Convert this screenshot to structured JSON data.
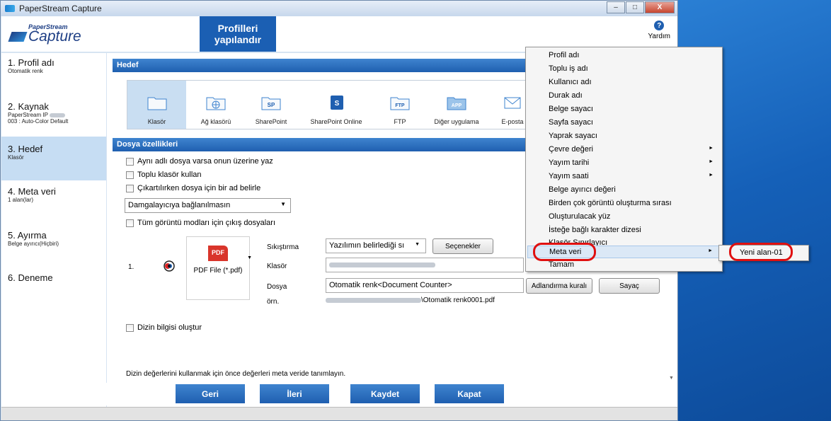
{
  "window": {
    "title": "PaperStream Capture",
    "buttons": {
      "minimize": "–",
      "maximize": "□",
      "close": "X"
    }
  },
  "header": {
    "logo_top": "PaperStream",
    "logo_bottom": "Capture",
    "tab_line1": "Profilleri",
    "tab_line2": "yapılandır",
    "help_icon": "?",
    "help_label": "Yardım"
  },
  "sidebar": {
    "steps": [
      {
        "label": "1. Profil adı",
        "sub": "Otomatik renk"
      },
      {
        "label": "2. Kaynak",
        "sub": "PaperStream IP",
        "sub2": "003 : Auto-Color Default"
      },
      {
        "label": "3. Hedef",
        "sub": "Klasör"
      },
      {
        "label": "4. Meta veri",
        "sub": "1 alan(lar)"
      },
      {
        "label": "5. Ayırma",
        "sub": "Belge ayırıcı(Hiçbiri)"
      },
      {
        "label": "6. Deneme",
        "sub": ""
      }
    ]
  },
  "destination": {
    "section_title": "Hedef",
    "items": [
      {
        "label": "Klasör",
        "icon": "folder-icon"
      },
      {
        "label": "Ağ klasörü",
        "icon": "network-folder-icon"
      },
      {
        "label": "SharePoint",
        "icon": "sharepoint-icon",
        "badge": "SP"
      },
      {
        "label": "SharePoint Online",
        "icon": "sharepoint-online-icon",
        "badge": "S"
      },
      {
        "label": "FTP",
        "icon": "ftp-icon",
        "badge": "FTP"
      },
      {
        "label": "Diğer uygulama",
        "icon": "app-icon",
        "badge": "APP"
      },
      {
        "label": "E-posta",
        "icon": "email-icon"
      }
    ]
  },
  "file_props": {
    "section_title": "Dosya özellikleri",
    "overwrite": "Aynı adlı dosya varsa onun üzerine yaz",
    "batch_folder": "Toplu klasör kullan",
    "name_on_eject": "Çıkartılırken dosya için bir ad belirle",
    "imprinter_select": "Damgalayıcıya bağlanılmasın",
    "all_modes": "Tüm görüntü modları için çıkış dosyaları",
    "row_index": "1.",
    "pdf_badge": "PDF",
    "file_type": "PDF File (*.pdf)",
    "compression_label": "Sıkıştırma",
    "compression_value": "Yazılımın belirlediği sı",
    "options_button": "Seçenekler",
    "folder_label": "Klasör",
    "file_label": "Dosya",
    "file_value": "Otomatik renk<Document Counter>",
    "naming_rule_button": "Adlandırma kuralı",
    "counter_button": "Sayaç",
    "example_label": "örn.",
    "example_value": "\\Otomatik renk0001.pdf",
    "index_info": "Dizin bilgisi oluştur",
    "note": "Dizin değerlerini kullanmak için önce değerleri meta veride tanımlayın."
  },
  "nav": {
    "back": "Geri",
    "next": "İleri",
    "save": "Kaydet",
    "close": "Kapat"
  },
  "context_menu": {
    "items": [
      {
        "label": "Profil adı",
        "submenu": false
      },
      {
        "label": "Toplu iş adı",
        "submenu": false
      },
      {
        "label": "Kullanıcı adı",
        "submenu": false
      },
      {
        "label": "Durak adı",
        "submenu": false
      },
      {
        "label": "Belge sayacı",
        "submenu": false
      },
      {
        "label": "Sayfa sayacı",
        "submenu": false
      },
      {
        "label": "Yaprak sayacı",
        "submenu": false
      },
      {
        "label": "Çevre değeri",
        "submenu": true
      },
      {
        "label": "Yayım tarihi",
        "submenu": true
      },
      {
        "label": "Yayım saati",
        "submenu": true
      },
      {
        "label": "Belge ayırıcı değeri",
        "submenu": false
      },
      {
        "label": "Birden çok görüntü oluşturma sırası",
        "submenu": false
      },
      {
        "label": "Oluşturulacak yüz",
        "submenu": false
      },
      {
        "label": "İsteğe bağlı karakter dizesi",
        "submenu": false
      },
      {
        "label": "Klasör Sınırlayıcı",
        "submenu": false
      },
      {
        "label": "Meta veri",
        "submenu": true
      },
      {
        "label": "Tamam",
        "submenu": false
      }
    ],
    "submenu_arrow": "►",
    "submenu_item": "Yeni alan-01"
  },
  "colors": {
    "accent": "#1f5fb0",
    "highlight_ring": "#e01010"
  }
}
